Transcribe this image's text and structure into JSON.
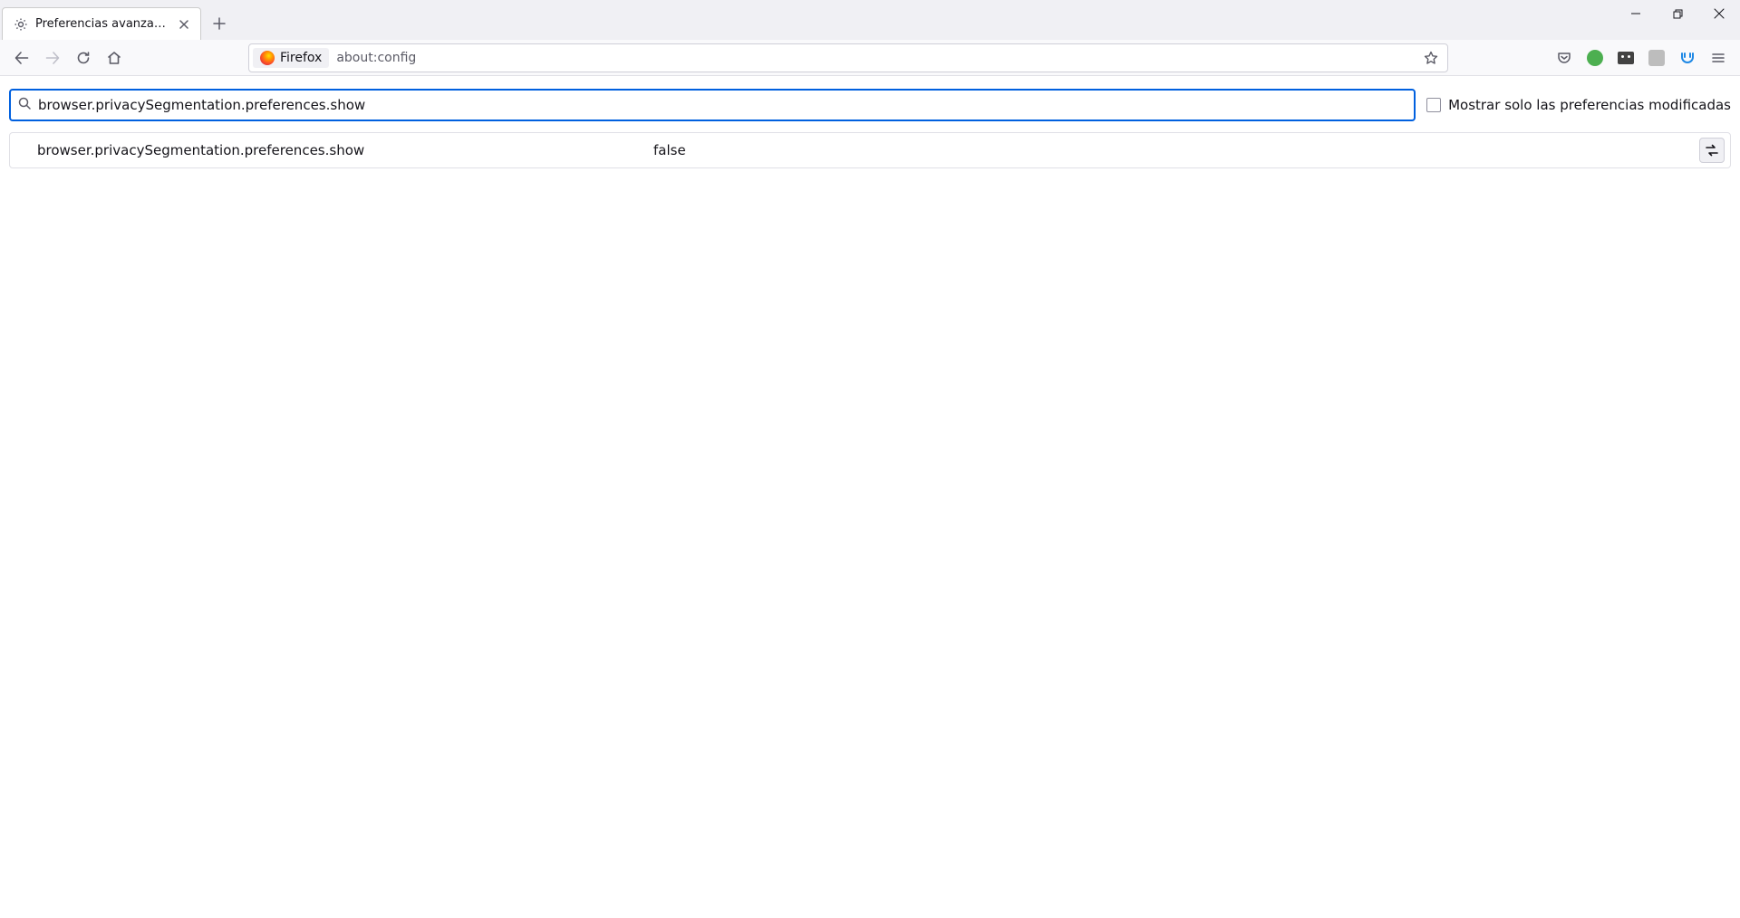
{
  "window": {
    "tab_title": "Preferencias avanzadas"
  },
  "urlbar": {
    "identity_label": "Firefox",
    "url": "about:config"
  },
  "search": {
    "value": "browser.privacySegmentation.preferences.show",
    "filter_label": "Mostrar solo las preferencias modificadas"
  },
  "preferences": [
    {
      "name": "browser.privacySegmentation.preferences.show",
      "value": "false"
    }
  ]
}
